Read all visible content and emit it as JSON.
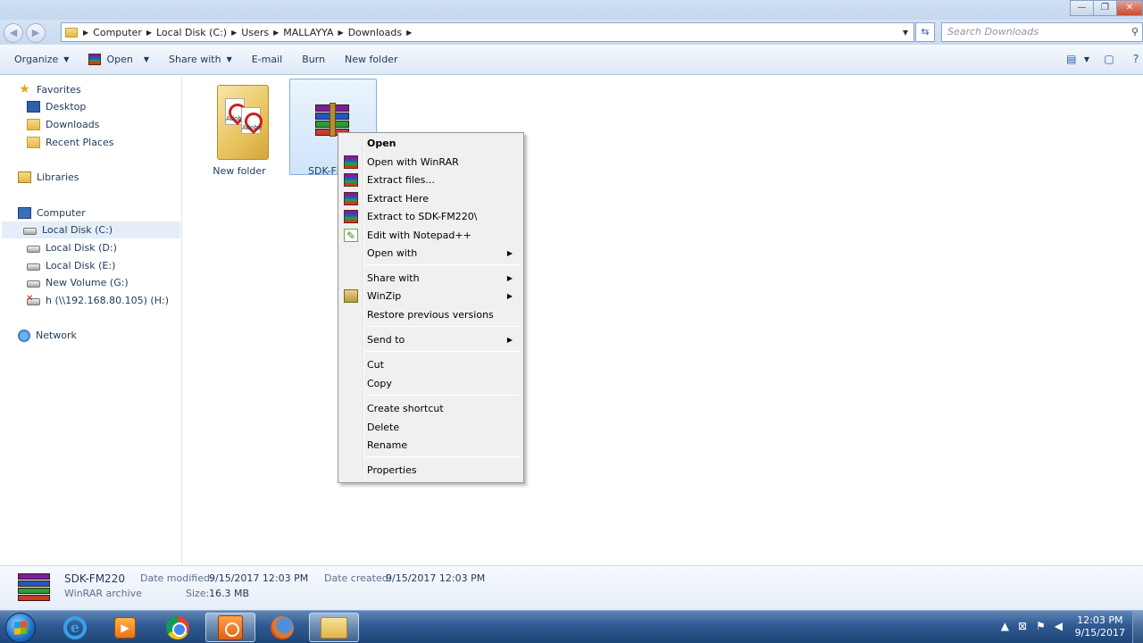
{
  "window": {
    "minimize": "—",
    "maximize": "❐",
    "close": "✕"
  },
  "address": {
    "crumbs": [
      "Computer",
      "Local Disk (C:)",
      "Users",
      "MALLAYYA",
      "Downloads"
    ],
    "search_placeholder": "Search Downloads"
  },
  "toolbar": {
    "organize": "Organize",
    "open": "Open",
    "share_with": "Share with",
    "email": "E-mail",
    "burn": "Burn",
    "new_folder": "New folder"
  },
  "nav": {
    "favorites": "Favorites",
    "desktop": "Desktop",
    "downloads": "Downloads",
    "recent_places": "Recent Places",
    "libraries": "Libraries",
    "computer": "Computer",
    "drive_c": "Local Disk (C:)",
    "drive_d": "Local Disk (D:)",
    "drive_e": "Local Disk (E:)",
    "drive_g": "New Volume (G:)",
    "drive_h": "h (\\\\192.168.80.105) (H:)",
    "network": "Network"
  },
  "files": [
    {
      "name": "New folder"
    },
    {
      "name": "SDK-FM220"
    }
  ],
  "context_menu": {
    "open": "Open",
    "open_with_winrar": "Open with WinRAR",
    "extract_files": "Extract files...",
    "extract_here": "Extract Here",
    "extract_to": "Extract to SDK-FM220\\",
    "edit_notepad": "Edit with Notepad++",
    "open_with": "Open with",
    "share_with": "Share with",
    "winzip": "WinZip",
    "restore": "Restore previous versions",
    "send_to": "Send to",
    "cut": "Cut",
    "copy": "Copy",
    "create_shortcut": "Create shortcut",
    "delete": "Delete",
    "rename": "Rename",
    "properties": "Properties"
  },
  "details": {
    "name": "SDK-FM220",
    "type": "WinRAR archive",
    "modified_label": "Date modified:",
    "modified_value": "9/15/2017 12:03 PM",
    "size_label": "Size:",
    "size_value": "16.3 MB",
    "created_label": "Date created:",
    "created_value": "9/15/2017 12:03 PM"
  },
  "taskbar": {
    "time": "12:03 PM",
    "date": "9/15/2017"
  }
}
